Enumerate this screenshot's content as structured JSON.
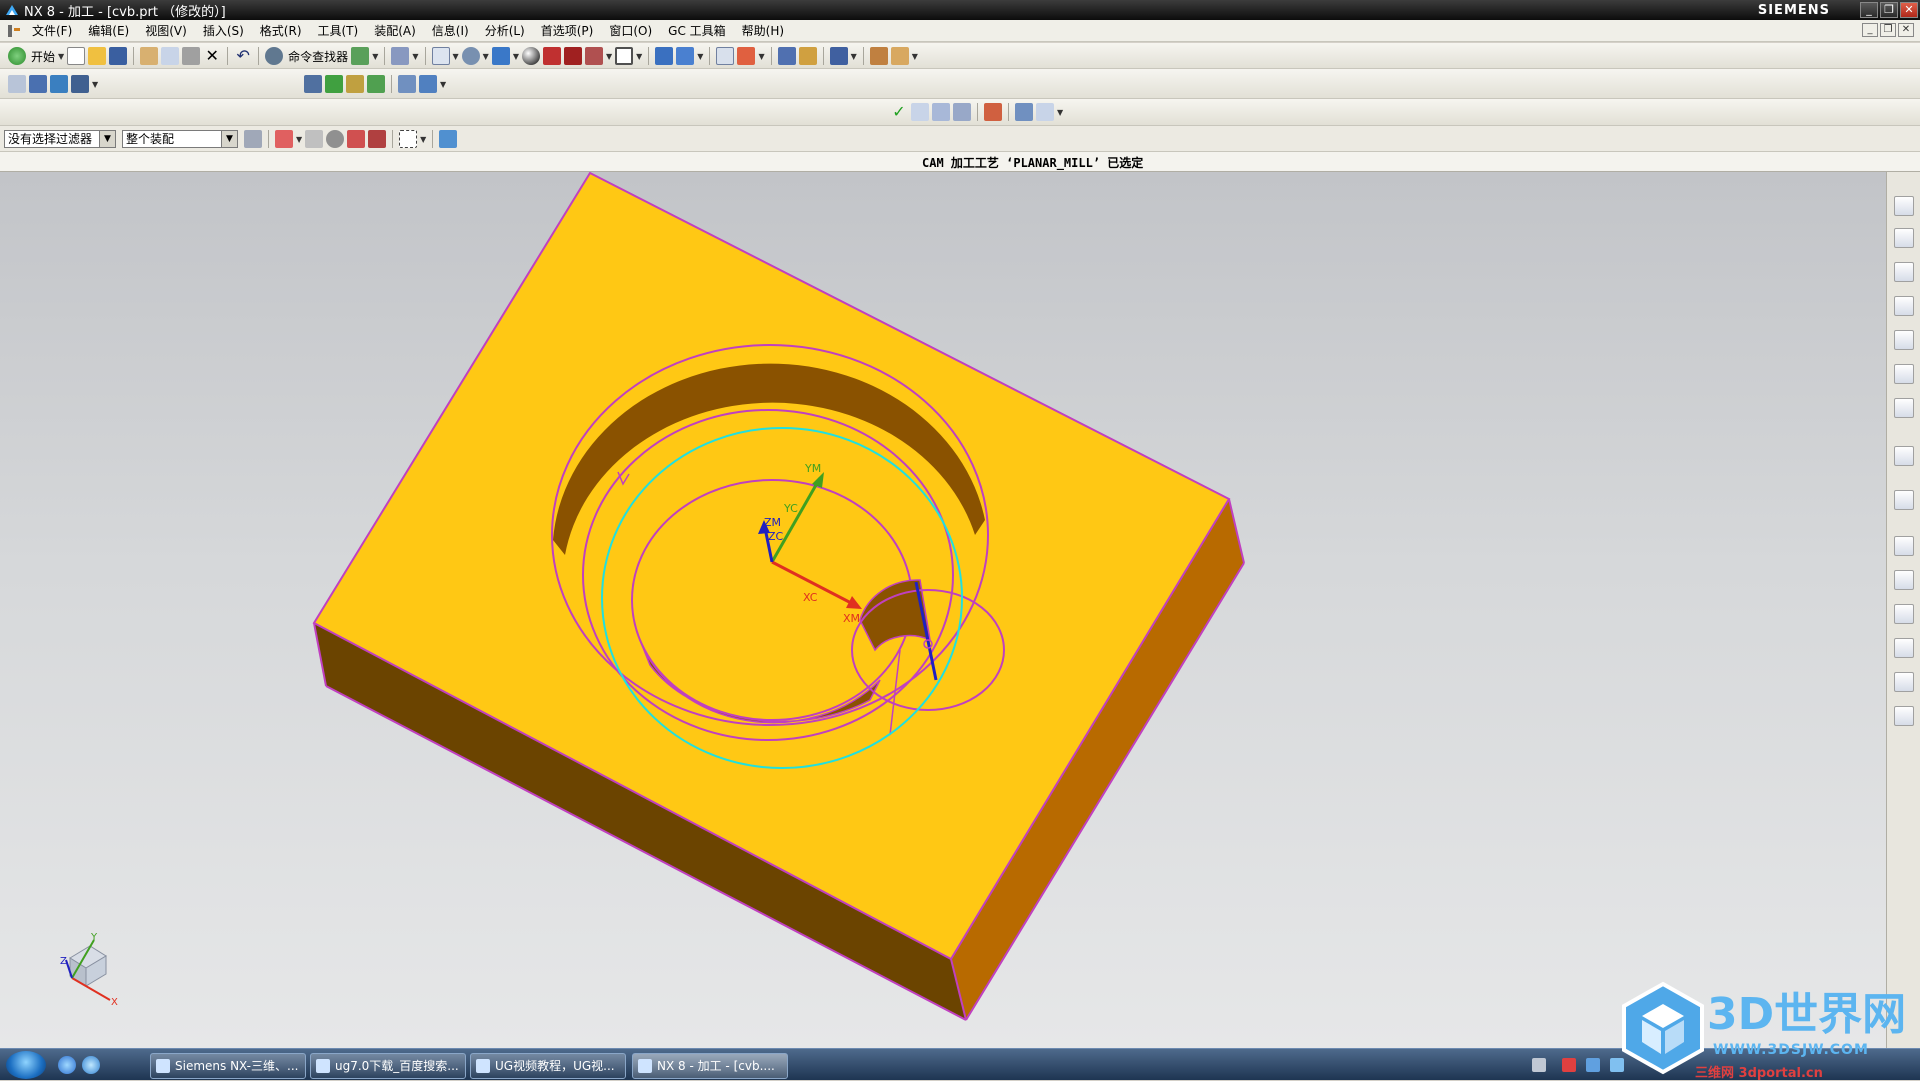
{
  "window": {
    "title": "NX 8 - 加工 - [cvb.prt （修改的）]",
    "brand": "SIEMENS",
    "controls": [
      "_",
      "❐",
      "✕"
    ]
  },
  "menu": [
    "文件(F)",
    "编辑(E)",
    "视图(V)",
    "插入(S)",
    "格式(R)",
    "工具(T)",
    "装配(A)",
    "信息(I)",
    "分析(L)",
    "首选项(P)",
    "窗口(O)",
    "GC 工具箱",
    "帮助(H)"
  ],
  "toolbar": {
    "start_label": "开始",
    "command_finder_label": "命令查找器"
  },
  "filter": {
    "selection_filter": "没有选择过滤器",
    "scope": "整个装配"
  },
  "status": {
    "message": "CAM 加工工艺 ‘PLANAR_MILL’ 已选定"
  },
  "viewport": {
    "axis_labels": {
      "ym": "YM",
      "yc": "YC",
      "zm": "ZM",
      "zc": "ZC",
      "xc": "XC",
      "xm": "XM",
      "triad_x": "X",
      "triad_y": "Y",
      "triad_z": "Z"
    },
    "colors": {
      "part_top": "#FFC814",
      "part_side_front": "#6B4400",
      "part_side_right": "#B86A00",
      "edge": "#C040C0",
      "tool_path_circle": "#20E0E0",
      "x_axis": "#E03020",
      "y_axis": "#40A020",
      "z_axis": "#2020C0"
    }
  },
  "taskbar": {
    "buttons": [
      "Siemens NX-三维、...",
      "ug7.0下载_百度搜索...",
      "UG视频教程，UG视...",
      "NX 8 - 加工 - [cvb...."
    ]
  },
  "watermark": {
    "text": "3D世界网",
    "url": "WWW.3DSJW.COM",
    "sub": "三维网 3dportal.cn"
  }
}
